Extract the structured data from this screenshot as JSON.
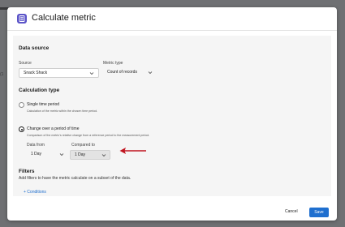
{
  "background": {
    "fragment": "(1"
  },
  "dialog": {
    "title": "Calculate metric"
  },
  "data_source": {
    "heading": "Data source",
    "source": {
      "label": "Source",
      "value": "Snack Shack"
    },
    "metric_type": {
      "label": "Metric type",
      "value": "Count of records"
    }
  },
  "calculation_type": {
    "heading": "Calculation type",
    "options": [
      {
        "label": "Single time period",
        "description": "Calculation of the metric within the chosen time period.",
        "selected": false
      },
      {
        "label": "Change over a period of time",
        "description": "Comparison of the metric's relative change from a reference period to the measurement period.",
        "selected": true
      }
    ],
    "data_from": {
      "label": "Data from",
      "value": "1 Day"
    },
    "compared_to": {
      "label": "Compared to",
      "value": "1 Day"
    }
  },
  "filters": {
    "heading": "Filters",
    "description": "Add filters to have the metric calculate on a subset of the data.",
    "add_link": "+ Conditions"
  },
  "footer": {
    "cancel_label": "Cancel",
    "save_label": "Save"
  },
  "colors": {
    "overlay": "#6f7073",
    "accent": "#1f6fcf",
    "icon": "#5b54c8",
    "arrow": "#c0141f"
  },
  "icons": {
    "app": "calculator-icon",
    "dropdown": "chevron-down-icon",
    "annotation": "red-arrow-icon"
  }
}
